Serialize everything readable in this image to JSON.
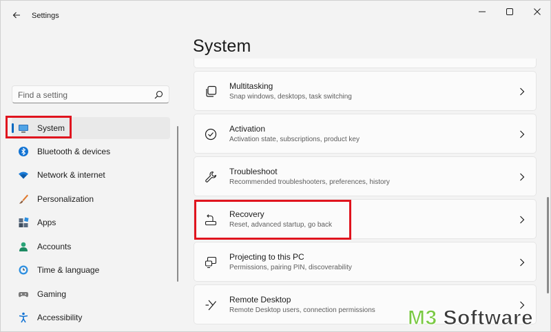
{
  "window": {
    "app_title": "Settings"
  },
  "search": {
    "placeholder": "Find a setting"
  },
  "sidebar": {
    "items": [
      {
        "label": "System",
        "icon": "monitor-icon",
        "active": true
      },
      {
        "label": "Bluetooth & devices",
        "icon": "bluetooth-icon"
      },
      {
        "label": "Network & internet",
        "icon": "wifi-icon"
      },
      {
        "label": "Personalization",
        "icon": "brush-icon"
      },
      {
        "label": "Apps",
        "icon": "apps-icon"
      },
      {
        "label": "Accounts",
        "icon": "person-icon"
      },
      {
        "label": "Time & language",
        "icon": "globe-clock-icon"
      },
      {
        "label": "Gaming",
        "icon": "gamepad-icon"
      },
      {
        "label": "Accessibility",
        "icon": "accessibility-icon"
      }
    ]
  },
  "main": {
    "title": "System",
    "cards": [
      {
        "title": "Multitasking",
        "subtitle": "Snap windows, desktops, task switching",
        "icon": "multitasking-icon"
      },
      {
        "title": "Activation",
        "subtitle": "Activation state, subscriptions, product key",
        "icon": "check-circle-icon"
      },
      {
        "title": "Troubleshoot",
        "subtitle": "Recommended troubleshooters, preferences, history",
        "icon": "wrench-icon"
      },
      {
        "title": "Recovery",
        "subtitle": "Reset, advanced startup, go back",
        "icon": "recovery-icon"
      },
      {
        "title": "Projecting to this PC",
        "subtitle": "Permissions, pairing PIN, discoverability",
        "icon": "projector-icon"
      },
      {
        "title": "Remote Desktop",
        "subtitle": "Remote Desktop users, connection permissions",
        "icon": "remote-desktop-icon"
      }
    ]
  },
  "watermark": {
    "brand": "M3",
    "suffix": " Software"
  },
  "colors": {
    "accent": "#0067c0",
    "highlight": "#e0141e",
    "background": "#f3f3f3",
    "card": "#fbfbfb"
  }
}
